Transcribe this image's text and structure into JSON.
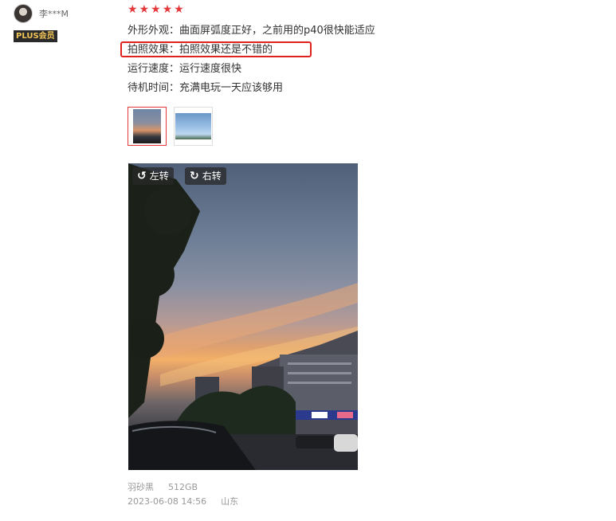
{
  "user": {
    "name": "李***M",
    "badge": "PLUS会员",
    "avatar_icon": "user-avatar"
  },
  "rating": {
    "stars": 5,
    "max": 5,
    "color": "#e4393c"
  },
  "review": {
    "lines": [
      "外形外观：曲面屏弧度正好，之前用的p40很快能适应",
      "拍照效果：拍照效果还是不错的",
      "运行速度：运行速度很快",
      "待机时间：充满电玩一天应该够用"
    ],
    "highlighted_line_index": 1,
    "highlight_color": "#e0221f"
  },
  "gallery": {
    "thumbnails": [
      {
        "name": "sunset-photo-thumb",
        "selected": true
      },
      {
        "name": "sky-photo-thumb",
        "selected": false
      }
    ],
    "viewer": {
      "rotate_left_label": "左转",
      "rotate_right_label": "右转"
    }
  },
  "product": {
    "color": "羽砂黑",
    "storage": "512GB"
  },
  "post": {
    "date": "2023-06-08 14:56",
    "location": "山东"
  }
}
